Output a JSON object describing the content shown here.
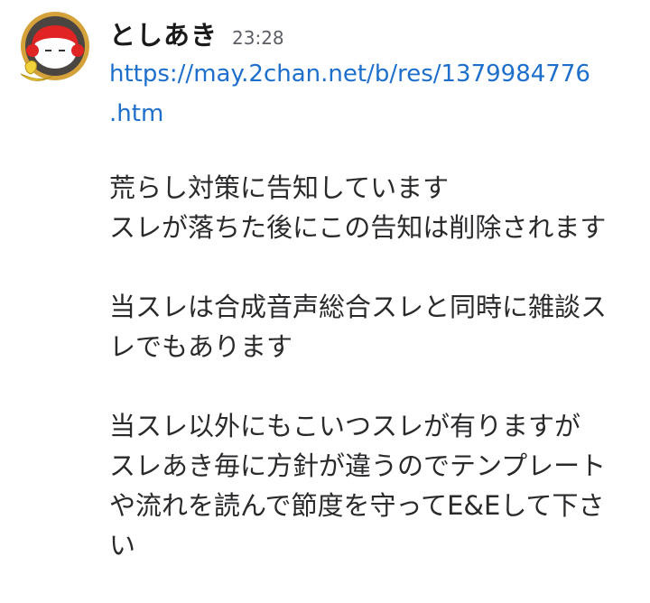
{
  "message": {
    "author": "としあき",
    "time": "23:28",
    "link_lines": [
      "https://may.2chan.net/b/res/1379984776",
      ".htm"
    ],
    "paragraphs": [
      [
        "荒らし対策に告知しています",
        "スレが落ちた後にこの告知は削除されます"
      ],
      [
        "当スレは合成音声総合スレと同時に雑談ス",
        "レでもあります"
      ],
      [
        "当スレ以外にもこいつスレが有りますが",
        "スレあき毎に方針が違うのでテンプレート",
        "や流れを読んで節度を守ってE&Eして下さ",
        "い"
      ]
    ]
  },
  "colors": {
    "link": "#1e6fcc",
    "timestamp": "#5c5e66",
    "text": "#2a2a2d"
  }
}
